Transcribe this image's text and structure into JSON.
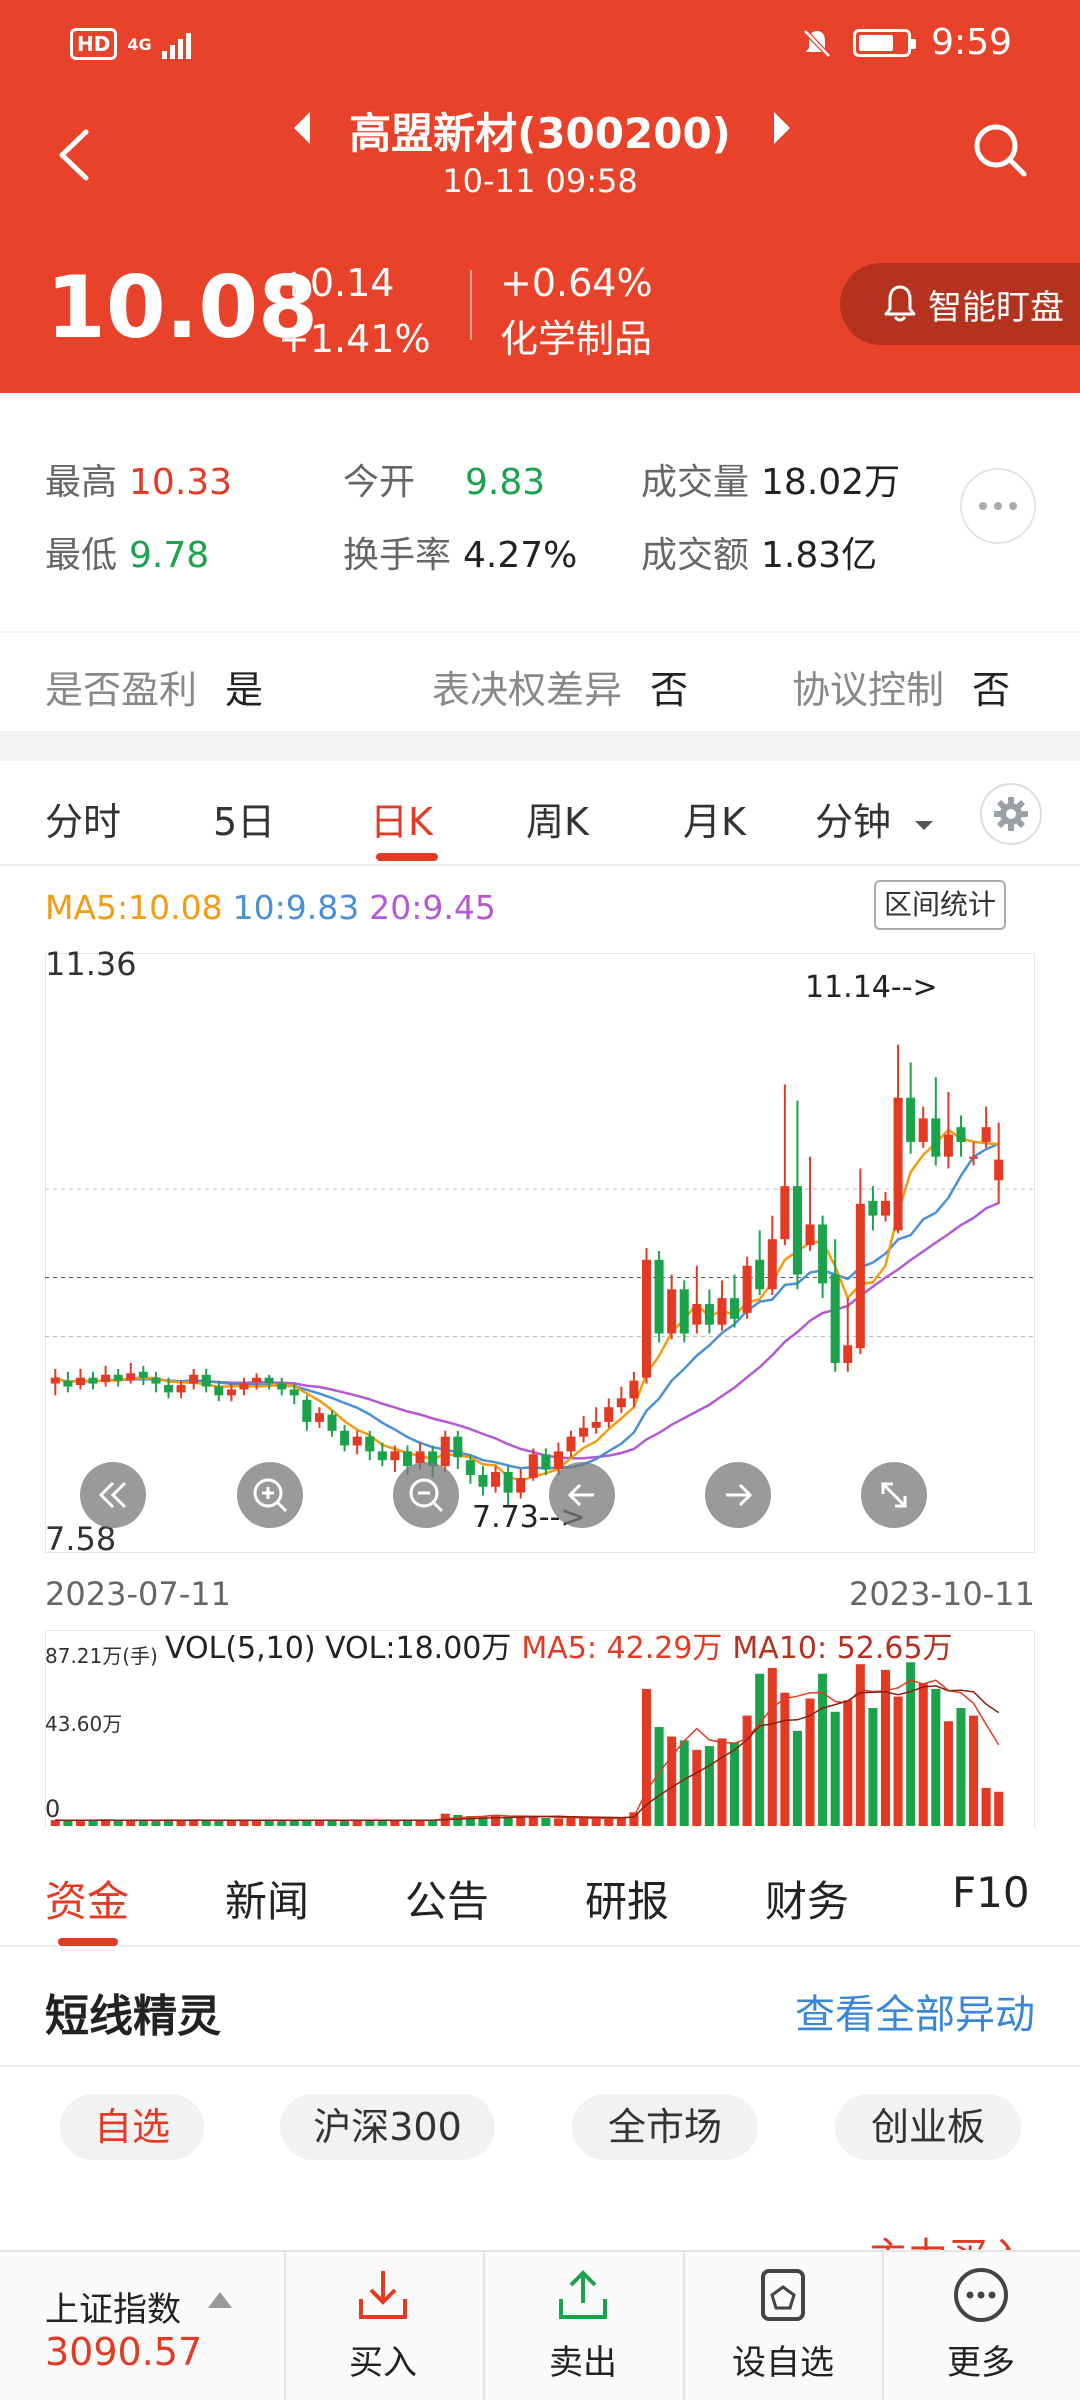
{
  "status_bar": {
    "network": "HD",
    "signal_label": "4G",
    "time": "9:59"
  },
  "header": {
    "title": "高盟新材(300200)",
    "datetime": "10-11 09:58",
    "price": "10.08",
    "change": "+0.14",
    "change_pct": "+1.41%",
    "sector_change": "+0.64%",
    "sector": "化学制品",
    "smart_watch_label": "智能盯盘"
  },
  "quote": {
    "high_label": "最高",
    "high": "10.33",
    "low_label": "最低",
    "low": "9.78",
    "open_label": "今开",
    "open": "9.83",
    "turnover_label": "换手率",
    "turnover": "4.27%",
    "volume_label": "成交量",
    "volume": "18.02万",
    "amount_label": "成交额",
    "amount": "1.83亿"
  },
  "flags": {
    "profit_label": "是否盈利",
    "profit": "是",
    "voting_label": "表决权差异",
    "voting": "否",
    "agreement_label": "协议控制",
    "agreement": "否"
  },
  "period_tabs": [
    {
      "label": "分时"
    },
    {
      "label": "5日"
    },
    {
      "label": "日K"
    },
    {
      "label": "周K"
    },
    {
      "label": "月K"
    },
    {
      "label": "分钟"
    }
  ],
  "active_period": "日K",
  "ma_legend": {
    "ma5": "MA5:10.08",
    "ma10": "10:9.83",
    "ma20": "20:9.45"
  },
  "range_stats_label": "区间统计",
  "chart_data": {
    "type": "candlestick",
    "y_max_label": "11.36",
    "y_min_label": "7.58",
    "ylim": [
      7.58,
      11.36
    ],
    "x_start": "2023-07-11",
    "x_end": "2023-10-11",
    "high_annotation": "11.14-->",
    "low_annotation": "7.73-->",
    "candles": [
      [
        8.56,
        8.6,
        8.66,
        8.48
      ],
      [
        8.58,
        8.54,
        8.64,
        8.5
      ],
      [
        8.55,
        8.6,
        8.66,
        8.52
      ],
      [
        8.6,
        8.56,
        8.64,
        8.52
      ],
      [
        8.57,
        8.62,
        8.68,
        8.54
      ],
      [
        8.62,
        8.58,
        8.66,
        8.54
      ],
      [
        8.58,
        8.63,
        8.7,
        8.56
      ],
      [
        8.64,
        8.6,
        8.68,
        8.55
      ],
      [
        8.6,
        8.56,
        8.64,
        8.5
      ],
      [
        8.55,
        8.5,
        8.6,
        8.46
      ],
      [
        8.5,
        8.55,
        8.58,
        8.46
      ],
      [
        8.56,
        8.62,
        8.66,
        8.52
      ],
      [
        8.62,
        8.54,
        8.66,
        8.5
      ],
      [
        8.54,
        8.48,
        8.58,
        8.44
      ],
      [
        8.48,
        8.52,
        8.56,
        8.44
      ],
      [
        8.52,
        8.56,
        8.6,
        8.48
      ],
      [
        8.57,
        8.6,
        8.63,
        8.52
      ],
      [
        8.6,
        8.56,
        8.62,
        8.52
      ],
      [
        8.56,
        8.52,
        8.6,
        8.48
      ],
      [
        8.52,
        8.48,
        8.56,
        8.42
      ],
      [
        8.45,
        8.3,
        8.48,
        8.24
      ],
      [
        8.3,
        8.36,
        8.4,
        8.26
      ],
      [
        8.35,
        8.24,
        8.38,
        8.2
      ],
      [
        8.24,
        8.14,
        8.28,
        8.1
      ],
      [
        8.14,
        8.2,
        8.24,
        8.08
      ],
      [
        8.2,
        8.1,
        8.24,
        8.04
      ],
      [
        8.1,
        8.04,
        8.16,
        8.0
      ],
      [
        8.04,
        8.1,
        8.14,
        7.96
      ],
      [
        8.1,
        8.0,
        8.14,
        7.94
      ],
      [
        8.02,
        8.1,
        8.16,
        7.98
      ],
      [
        8.1,
        8.0,
        8.14,
        7.92
      ],
      [
        8.0,
        8.2,
        8.24,
        7.96
      ],
      [
        8.2,
        8.06,
        8.24,
        7.98
      ],
      [
        8.04,
        7.94,
        8.08,
        7.88
      ],
      [
        7.94,
        7.86,
        8.0,
        7.8
      ],
      [
        7.86,
        7.96,
        8.0,
        7.82
      ],
      [
        7.96,
        7.82,
        8.0,
        7.73
      ],
      [
        7.82,
        7.92,
        7.98,
        7.78
      ],
      [
        7.92,
        8.08,
        8.12,
        7.9
      ],
      [
        8.08,
        7.98,
        8.12,
        7.94
      ],
      [
        7.98,
        8.1,
        8.16,
        7.94
      ],
      [
        8.1,
        8.2,
        8.24,
        8.06
      ],
      [
        8.2,
        8.26,
        8.34,
        8.16
      ],
      [
        8.26,
        8.3,
        8.4,
        8.22
      ],
      [
        8.3,
        8.4,
        8.46,
        8.26
      ],
      [
        8.4,
        8.46,
        8.54,
        8.36
      ],
      [
        8.46,
        8.58,
        8.64,
        8.4
      ],
      [
        8.6,
        9.4,
        9.48,
        8.56
      ],
      [
        9.4,
        8.9,
        9.46,
        8.84
      ],
      [
        8.9,
        9.2,
        9.3,
        8.86
      ],
      [
        9.2,
        8.9,
        9.26,
        8.84
      ],
      [
        8.96,
        9.1,
        9.36,
        8.9
      ],
      [
        9.1,
        8.96,
        9.2,
        8.9
      ],
      [
        8.96,
        9.14,
        9.26,
        8.92
      ],
      [
        9.14,
        9.0,
        9.3,
        8.94
      ],
      [
        9.04,
        9.36,
        9.42,
        9.0
      ],
      [
        9.4,
        9.2,
        9.6,
        9.16
      ],
      [
        9.2,
        9.54,
        9.7,
        9.16
      ],
      [
        9.54,
        9.9,
        10.59,
        9.5
      ],
      [
        9.9,
        9.3,
        10.48,
        9.2
      ],
      [
        9.5,
        9.64,
        10.1,
        9.46
      ],
      [
        9.64,
        9.24,
        9.7,
        9.14
      ],
      [
        9.3,
        8.7,
        9.54,
        8.64
      ],
      [
        8.7,
        8.82,
        9.14,
        8.64
      ],
      [
        8.8,
        9.78,
        10.02,
        8.76
      ],
      [
        9.8,
        9.7,
        9.9,
        9.6
      ],
      [
        9.7,
        9.8,
        9.86,
        9.66
      ],
      [
        9.6,
        10.5,
        10.86,
        9.58
      ],
      [
        10.5,
        10.2,
        10.74,
        10.12
      ],
      [
        10.2,
        10.36,
        10.44,
        10.16
      ],
      [
        10.36,
        10.1,
        10.64,
        10.04
      ],
      [
        10.1,
        10.25,
        10.54,
        10.02
      ],
      [
        10.3,
        10.2,
        10.38,
        10.1
      ],
      [
        10.1,
        10.1,
        10.2,
        10.04
      ],
      [
        10.2,
        10.3,
        10.44,
        10.16
      ],
      [
        9.94,
        10.08,
        10.33,
        9.78
      ]
    ]
  },
  "volume": {
    "legend": "VOL(5,10) VOL:18.00万",
    "ma5": "MA5: 42.29万",
    "ma10": "MA10: 52.65万",
    "max_label": "87.21万(手)",
    "mid_label": "43.60万",
    "zero_label": "0",
    "vmax": 87.21,
    "bars": [
      3.1,
      2.8,
      3.2,
      2.9,
      3.4,
      2.7,
      3.0,
      3.3,
      2.6,
      3.5,
      2.9,
      3.1,
      2.8,
      2.7,
      3.2,
      3.0,
      2.9,
      3.3,
      2.6,
      3.1,
      3.4,
      2.8,
      3.0,
      2.7,
      3.2,
      2.9,
      3.1,
      2.8,
      3.0,
      3.3,
      2.9,
      6.5,
      5.8,
      5.2,
      4.9,
      5.6,
      4.8,
      5.5,
      4.6,
      4.2,
      4.0,
      4.3,
      4.1,
      3.9,
      4.2,
      4.5,
      7.2,
      72.0,
      52.0,
      47.0,
      45.0,
      40.0,
      42.0,
      46.0,
      44.0,
      58.0,
      80.0,
      83.0,
      70.0,
      50.0,
      67.0,
      80.0,
      60.0,
      66.0,
      85.0,
      62.0,
      82.0,
      68.0,
      86.0,
      75.0,
      72.0,
      55.0,
      62.0,
      58.0,
      20.0,
      18.0
    ]
  },
  "content_tabs": [
    {
      "label": "资金"
    },
    {
      "label": "新闻"
    },
    {
      "label": "公告"
    },
    {
      "label": "研报"
    },
    {
      "label": "财务"
    },
    {
      "label": "F10"
    }
  ],
  "short_sprite": {
    "title": "短线精灵",
    "view_all": "查看全部异动"
  },
  "market_pills": [
    {
      "label": "自选"
    },
    {
      "label": "沪深300"
    },
    {
      "label": "全市场"
    },
    {
      "label": "创业板"
    }
  ],
  "partial_text": "主力买入",
  "bottom_bar": {
    "index_name": "上证指数",
    "index_value": "3090.57",
    "buy": "买入",
    "sell": "卖出",
    "add_watch": "设自选",
    "more": "更多"
  },
  "colors": {
    "accent": "#e8432a",
    "up": "#e33a24",
    "down": "#1aa34a",
    "ma5": "#f39c12",
    "ma10": "#4a90d9",
    "ma20": "#b459d3",
    "link": "#3a86d8"
  }
}
